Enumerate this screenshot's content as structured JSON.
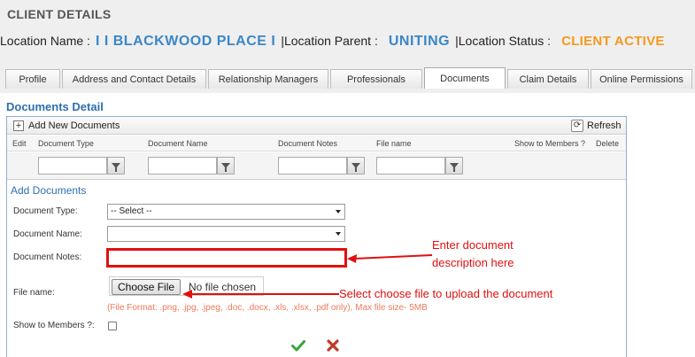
{
  "page": {
    "title": "CLIENT DETAILS"
  },
  "location": {
    "name_label": "Location Name :",
    "name_value": "I I BLACKWOOD PLACE I",
    "sep1": "|",
    "parent_label": "Location Parent :",
    "parent_value": "UNITING",
    "sep2": "|",
    "status_label": "Location Status :",
    "status_value": "CLIENT ACTIVE"
  },
  "tabs": [
    {
      "label": "Profile",
      "active": false
    },
    {
      "label": "Address and Contact Details",
      "active": false
    },
    {
      "label": "Relationship Managers",
      "active": false
    },
    {
      "label": "Professionals",
      "active": false
    },
    {
      "label": "Documents",
      "active": true
    },
    {
      "label": "Claim Details",
      "active": false
    },
    {
      "label": "Online Permissions",
      "active": false
    }
  ],
  "documents": {
    "section_title": "Documents Detail",
    "toolbar": {
      "add_icon": "+",
      "add_label": "Add New Documents",
      "refresh_icon": "⟳",
      "refresh_label": "Refresh"
    },
    "columns": [
      "Edit",
      "Document Type",
      "Document Name",
      "Document Notes",
      "File name",
      "Show to Members ?",
      "Delete"
    ],
    "icons": {
      "filter": "filter-icon",
      "ok": "check-icon",
      "cancel": "cross-icon"
    },
    "colors": {
      "accent_blue": "#2f6fb0",
      "orange": "#f39a1e",
      "annotation_red": "#e01010",
      "ok_green": "#3aa53a",
      "cancel_red": "#c0392b"
    }
  },
  "form": {
    "title": "Add Documents",
    "type_label": "Document Type:",
    "type_value": "-- Select --",
    "name_label": "Document Name:",
    "name_value": "",
    "notes_label": "Document Notes:",
    "notes_value": "",
    "file_label": "File name:",
    "file_button": "Choose File",
    "file_status": "No file chosen",
    "file_hint": "(File Format: .png, .jpg, .jpeg, .doc, .docx, .xls, .xlsx, .pdf only), Max file size- 5MB",
    "show_label": "Show to Members ?:",
    "show_checked": false
  },
  "annotations": {
    "notes_line1": "Enter document",
    "notes_line2": "description here",
    "file_hint": "Select choose file to upload the document"
  }
}
